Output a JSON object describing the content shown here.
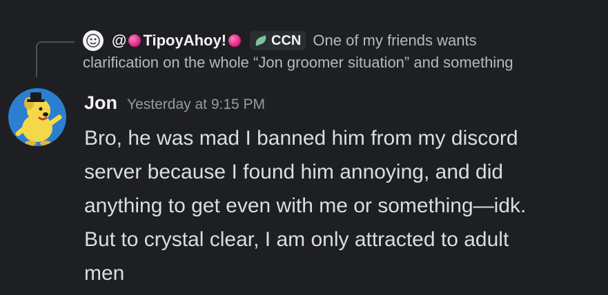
{
  "reply": {
    "mention_prefix": "@",
    "author": "TipoyAhoy!",
    "tag": "CCN",
    "preview_line1": "One of my friends wants",
    "preview_line2": "clarification on the whole “Jon groomer situation” and something"
  },
  "message": {
    "author": "Jon",
    "timestamp": "Yesterday at 9:15 PM",
    "lines": [
      "Bro, he was mad I banned him from my discord",
      "server because I found him annoying, and did",
      "anything to get even with me or something—idk.",
      "But to crystal clear, I am only attracted to adult",
      "men"
    ]
  },
  "colors": {
    "background": "#1e1f22",
    "text": "#dbdee1",
    "muted": "#949ba4",
    "username": "#f2f3f5",
    "avatar_bg": "#2c7fd0",
    "avatar_char": "#f5d84a"
  },
  "icons": [
    "reply-avatar-icon",
    "yarn-icon",
    "leaf-icon",
    "avatar"
  ]
}
